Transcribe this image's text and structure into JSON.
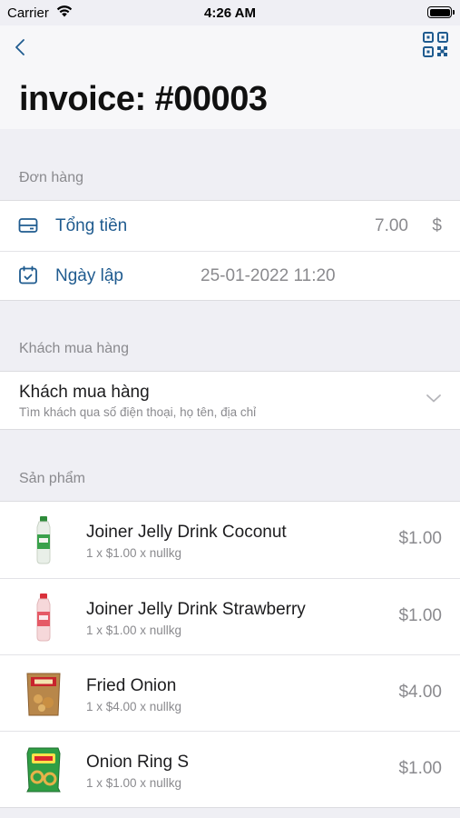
{
  "status_bar": {
    "carrier": "Carrier",
    "time": "4:26 AM"
  },
  "header": {
    "title": "invoice: #00003",
    "back_icon": "chevron-left-icon",
    "qr_icon": "qr-code-icon"
  },
  "order_section": {
    "label": "Đơn hàng",
    "total": {
      "label": "Tổng tiền",
      "value": "7.00",
      "currency": "$",
      "icon": "wallet-icon"
    },
    "created": {
      "label": "Ngày lập",
      "value": "25-01-2022 11:20",
      "icon": "calendar-icon"
    }
  },
  "customer_section": {
    "label": "Khách mua hàng",
    "field_title": "Khách mua hàng",
    "field_hint": "Tìm khách qua số điện thoại, họ tên, địa chỉ",
    "chevron_icon": "chevron-down-icon"
  },
  "products_section": {
    "label": "Sản phẩm",
    "items": [
      {
        "name": "Joiner Jelly Drink Coconut",
        "detail": "1 x $1.00 x nullkg",
        "price": "$1.00"
      },
      {
        "name": "Joiner Jelly Drink Strawberry",
        "detail": "1 x $1.00 x nullkg",
        "price": "$1.00"
      },
      {
        "name": "Fried Onion",
        "detail": "1 x $4.00 x nullkg",
        "price": "$4.00"
      },
      {
        "name": "Onion Ring S",
        "detail": "1 x $1.00 x nullkg",
        "price": "$1.00"
      }
    ]
  },
  "colors": {
    "accent": "#1f5b8f",
    "background": "#efeff4",
    "muted": "#8a8a8e"
  }
}
